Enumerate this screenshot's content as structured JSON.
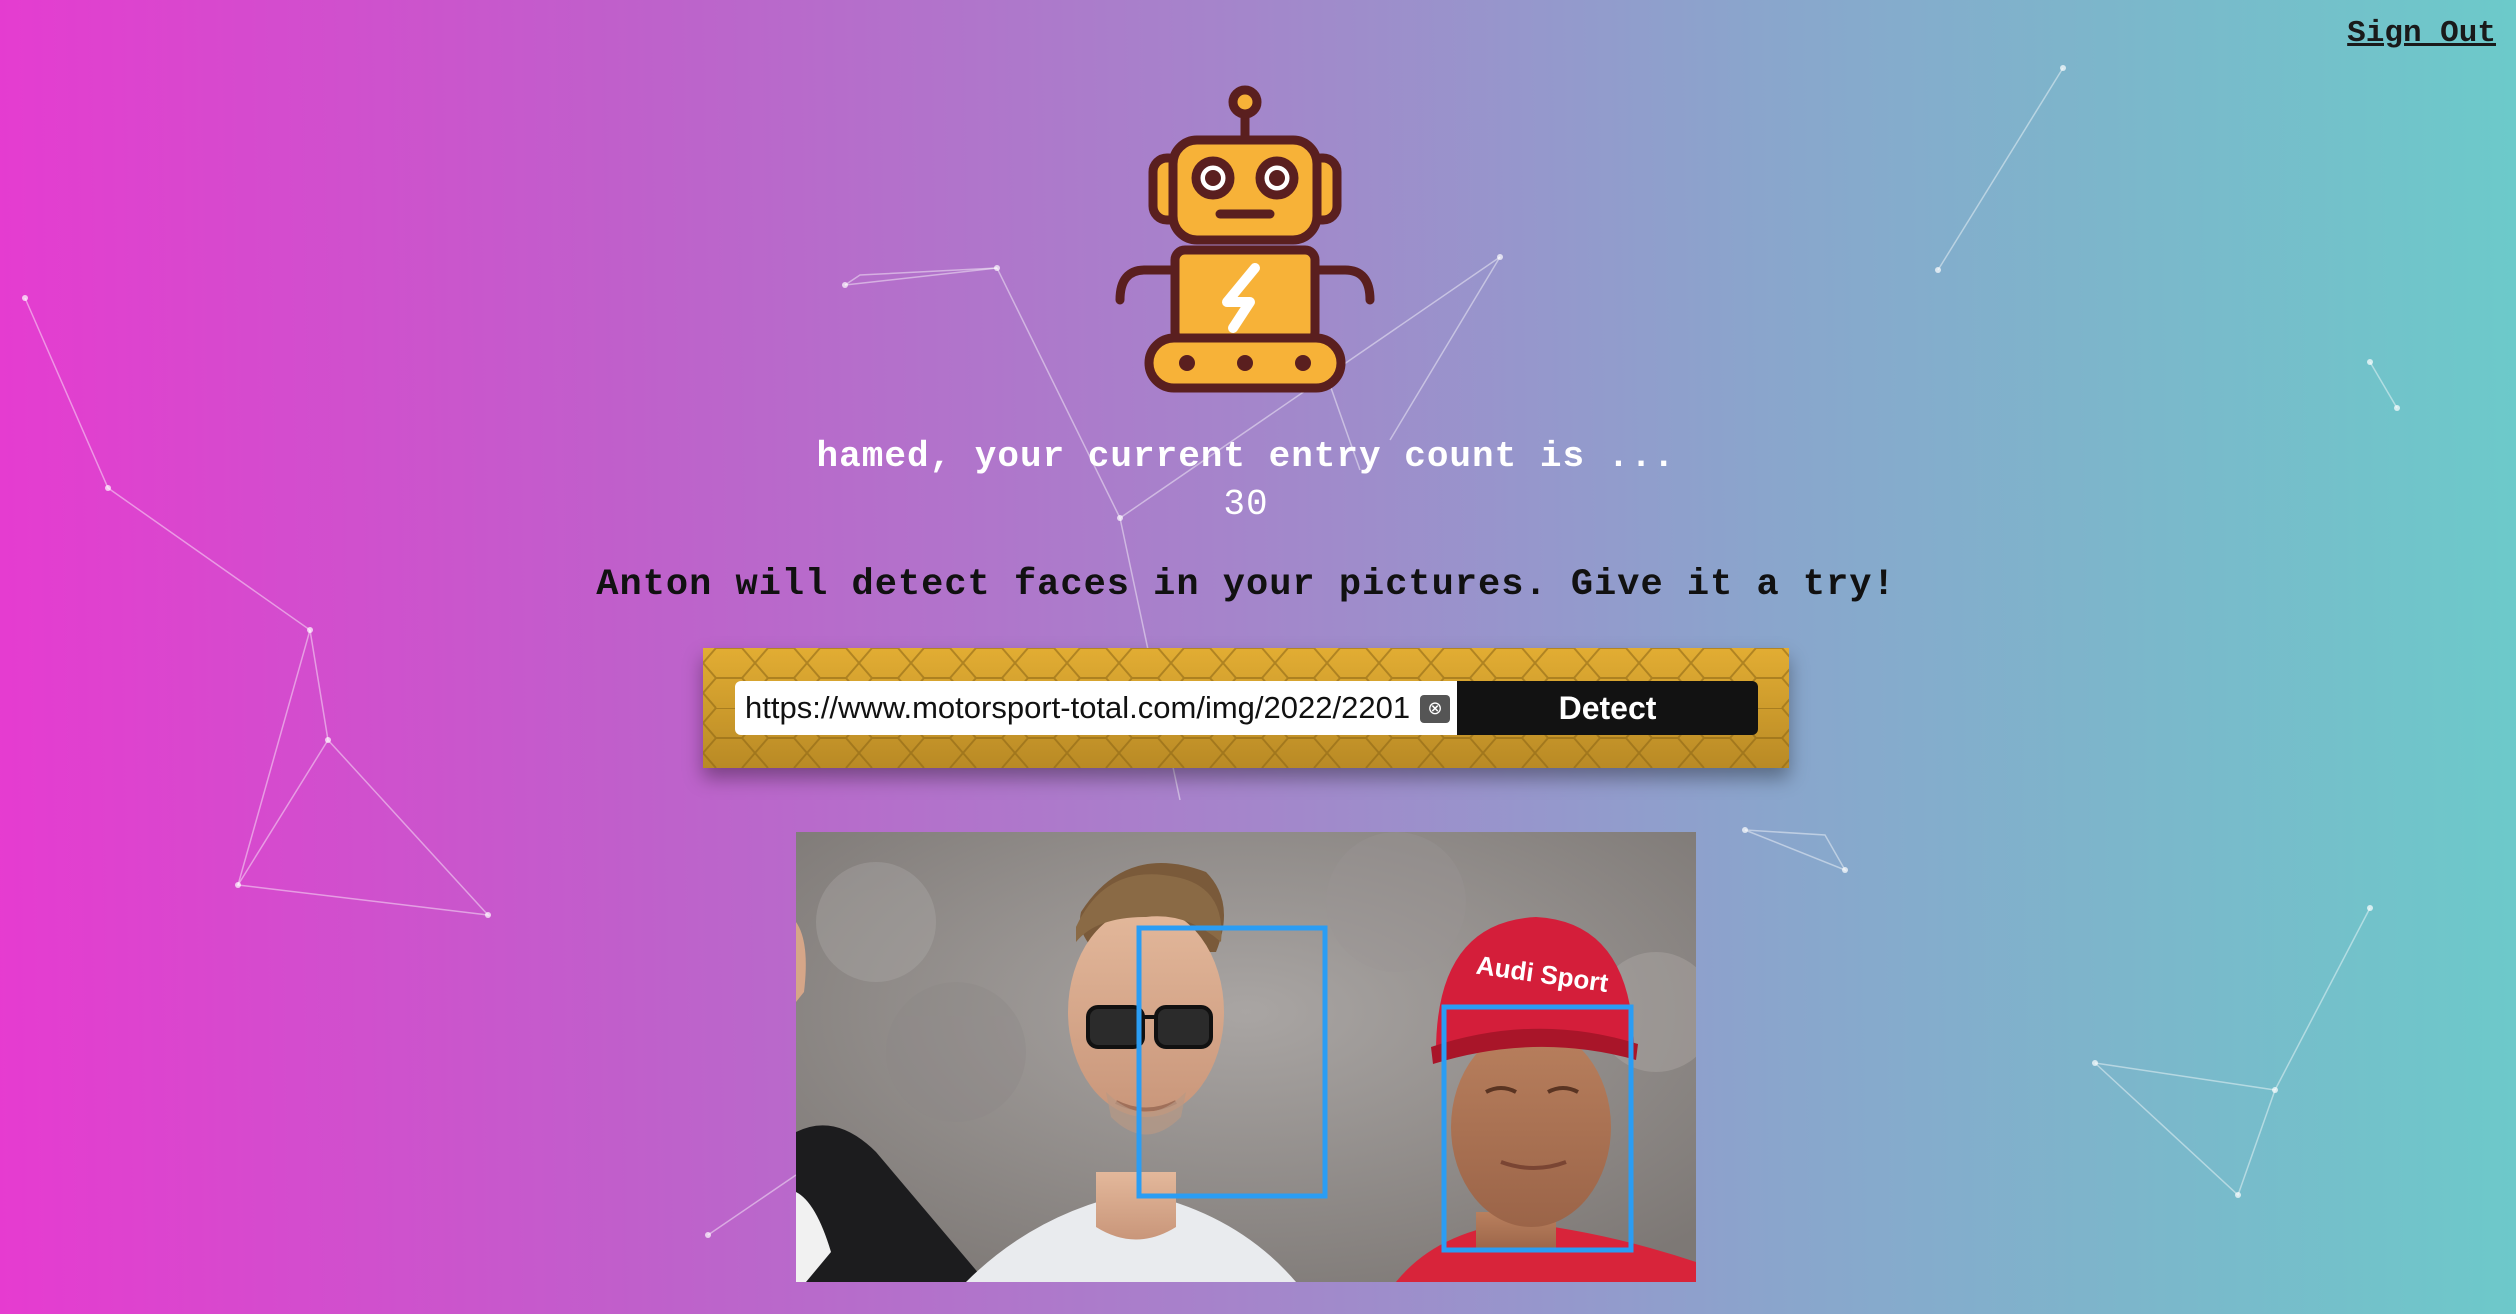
{
  "header": {
    "signout_label": "Sign Out"
  },
  "logo": {
    "icon": "robot-icon",
    "colors": {
      "body": "#f7b238",
      "outline": "#5a1f1f"
    }
  },
  "user": {
    "greeting": "hamed, your current entry count is ...",
    "entry_count": "30"
  },
  "main": {
    "tagline": "Anton will detect faces in your pictures. Give it a try!"
  },
  "form": {
    "url_value": "https://www.motorsport-total.com/img/2022/2201",
    "clear_icon": "clear-icon",
    "detect_label": "Detect",
    "panel_color": "#d9a42c"
  },
  "result": {
    "face_box_color": "#2a9df4",
    "faces_detected": 2,
    "cap_text": "Audi Sport"
  }
}
